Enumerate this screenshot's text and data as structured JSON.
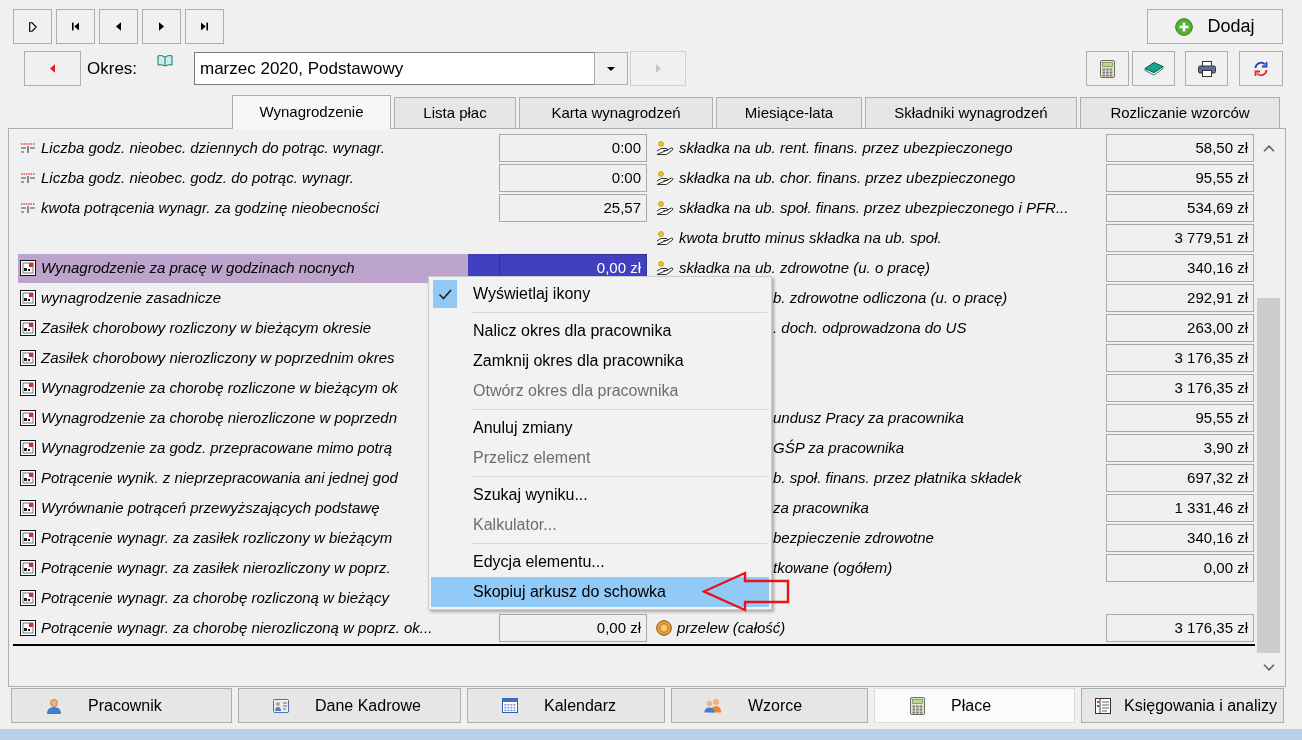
{
  "toolbar": {
    "add_button": {
      "label": "Dodaj"
    }
  },
  "period": {
    "label": "Okres:",
    "value": "marzec 2020, Podstawowy",
    "next_button": {
      "disabled": true
    }
  },
  "tabs": [
    {
      "label": "Wynagrodzenie",
      "selected": true
    },
    {
      "label": "Lista płac",
      "selected": false
    },
    {
      "label": "Karta wynagrodzeń",
      "selected": false
    },
    {
      "label": "Miesiące-lata",
      "selected": false
    },
    {
      "label": "Składniki wynagrodzeń",
      "selected": false
    },
    {
      "label": "Rozliczanie wzorców",
      "selected": false
    }
  ],
  "rows": [
    {
      "left": {
        "kind": "parameter",
        "label": "Liczba godz. nieobec. dziennych do potrąc. wynagr.",
        "value": "0:00",
        "selected": false
      },
      "right": {
        "kind": "contribution",
        "label": "składka na ub. rent. finans. przez ubezpieczonego",
        "value": "58,50 zł"
      }
    },
    {
      "left": {
        "kind": "parameter",
        "label": "Liczba godz. nieobec. godz. do potrąc. wynagr.",
        "value": "0:00",
        "selected": false
      },
      "right": {
        "kind": "contribution",
        "label": "składka na ub. chor. finans. przez ubezpieczonego",
        "value": "95,55 zł"
      }
    },
    {
      "left": {
        "kind": "parameter",
        "label": "kwota potrącenia wynagr. za godzinę nieobecności",
        "value": "25,57",
        "selected": false
      },
      "right": {
        "kind": "contribution",
        "label": "składka na ub. społ. finans. przez ubezpieczonego i PFR...",
        "value": "534,69 zł"
      }
    },
    {
      "right": {
        "kind": "contribution",
        "label": "kwota brutto minus składka na ub. społ.",
        "value": "3 779,51 zł"
      }
    },
    {
      "left": {
        "kind": "element",
        "label": "Wynagrodzenie za pracę w godzinach nocnych",
        "value": "0,00 zł",
        "selected": true
      },
      "right": {
        "kind": "contribution",
        "label": "składka na ub. zdrowotne (u. o pracę)",
        "value": "340,16 zł"
      }
    },
    {
      "left": {
        "kind": "element",
        "label": "wynagrodzenie zasadnicze",
        "selected": false
      },
      "right": {
        "label": "b. zdrowotne odliczona (u. o pracę)",
        "value": "292,91 zł"
      }
    },
    {
      "left": {
        "kind": "element",
        "label": "Zasiłek chorobowy rozliczony w bieżącym okresie",
        "selected": false
      },
      "right": {
        "label": ". doch. odprowadzona do US",
        "value": "263,00 zł"
      }
    },
    {
      "left": {
        "kind": "element",
        "label": "Zasiłek chorobowy nierozliczony w poprzednim okres",
        "selected": false
      },
      "right": {
        "value": "3 176,35 zł"
      }
    },
    {
      "left": {
        "kind": "element",
        "label": "Wynagrodzenie za chorobę rozliczone w bieżącym ok",
        "selected": false
      },
      "right": {
        "value": "3 176,35 zł"
      }
    },
    {
      "left": {
        "kind": "element",
        "label": "Wynagrodzenie za chorobę nierozliczone w poprzedn",
        "selected": false
      },
      "right": {
        "label": "undusz Pracy za pracownika",
        "value": "95,55 zł"
      }
    },
    {
      "left": {
        "kind": "element",
        "label": "Wynagrodzenie za godz. przepracowane mimo potrą",
        "selected": false
      },
      "right": {
        "label": "GŚP za pracownika",
        "value": "3,90 zł"
      }
    },
    {
      "left": {
        "kind": "element",
        "label": "Potrącenie wynik. z nieprzepracowania ani jednej god",
        "selected": false
      },
      "right": {
        "label": "b. społ. finans. przez płatnika składek",
        "value": "697,32 zł"
      }
    },
    {
      "left": {
        "kind": "element",
        "label": "Wyrównanie potrąceń przewyższających podstawę",
        "selected": false
      },
      "right": {
        "label": "za pracownika",
        "value": "1 331,46 zł"
      }
    },
    {
      "left": {
        "kind": "element",
        "label": "Potrącenie wynagr. za zasiłek rozliczony w bieżącym",
        "selected": false
      },
      "right": {
        "label": "bezpieczenie zdrowotne",
        "value": "340,16 zł"
      }
    },
    {
      "left": {
        "kind": "element",
        "label": "Potrącenie wynagr. za zasiłek nierozliczony w poprz.",
        "selected": false
      },
      "right": {
        "label": "tkowane (ogółem)",
        "value": "0,00 zł"
      }
    },
    {
      "left": {
        "kind": "element",
        "label": "Potrącenie wynagr. za chorobę rozliczoną w bieżący",
        "selected": false
      }
    },
    {
      "left": {
        "kind": "element",
        "label": "Potrącenie wynagr. za chorobę nierozliczoną w poprz. ok...",
        "value": "0,00 zł",
        "selected": false
      },
      "right": {
        "kind": "payment",
        "label": "przelew (całość)",
        "value": "3 176,35 zł"
      }
    }
  ],
  "context_menu": {
    "items": [
      {
        "kind": "item",
        "label": "Wyświetlaj ikony",
        "checked": true,
        "disabled": false,
        "selected": false
      },
      {
        "kind": "separator"
      },
      {
        "kind": "item",
        "label": "Nalicz okres dla pracownika",
        "checked": false,
        "disabled": false,
        "selected": false
      },
      {
        "kind": "item",
        "label": "Zamknij okres dla pracownika",
        "checked": false,
        "disabled": false,
        "selected": false
      },
      {
        "kind": "item",
        "label": "Otwórz okres dla pracownika",
        "checked": false,
        "disabled": true,
        "selected": false
      },
      {
        "kind": "separator"
      },
      {
        "kind": "item",
        "label": "Anuluj zmiany",
        "checked": false,
        "disabled": false,
        "selected": false
      },
      {
        "kind": "item",
        "label": "Przelicz element",
        "checked": false,
        "disabled": true,
        "selected": false
      },
      {
        "kind": "separator"
      },
      {
        "kind": "item",
        "label": "Szukaj wyniku...",
        "checked": false,
        "disabled": false,
        "selected": false
      },
      {
        "kind": "item",
        "label": "Kalkulator...",
        "checked": false,
        "disabled": true,
        "selected": false
      },
      {
        "kind": "separator"
      },
      {
        "kind": "item",
        "label": "Edycja elementu...",
        "checked": false,
        "disabled": false,
        "selected": false
      },
      {
        "kind": "item",
        "label": "Skopiuj arkusz do schowka",
        "checked": false,
        "disabled": false,
        "selected": true
      }
    ]
  },
  "bottom_tabs": [
    {
      "label": "Pracownik",
      "selected": false
    },
    {
      "label": "Dane Kadrowe",
      "selected": false
    },
    {
      "label": "Kalendarz",
      "selected": false
    },
    {
      "label": "Wzorce",
      "selected": false
    },
    {
      "label": "Płace",
      "selected": true
    },
    {
      "label": "Księgowania i analizy",
      "selected": false
    }
  ]
}
